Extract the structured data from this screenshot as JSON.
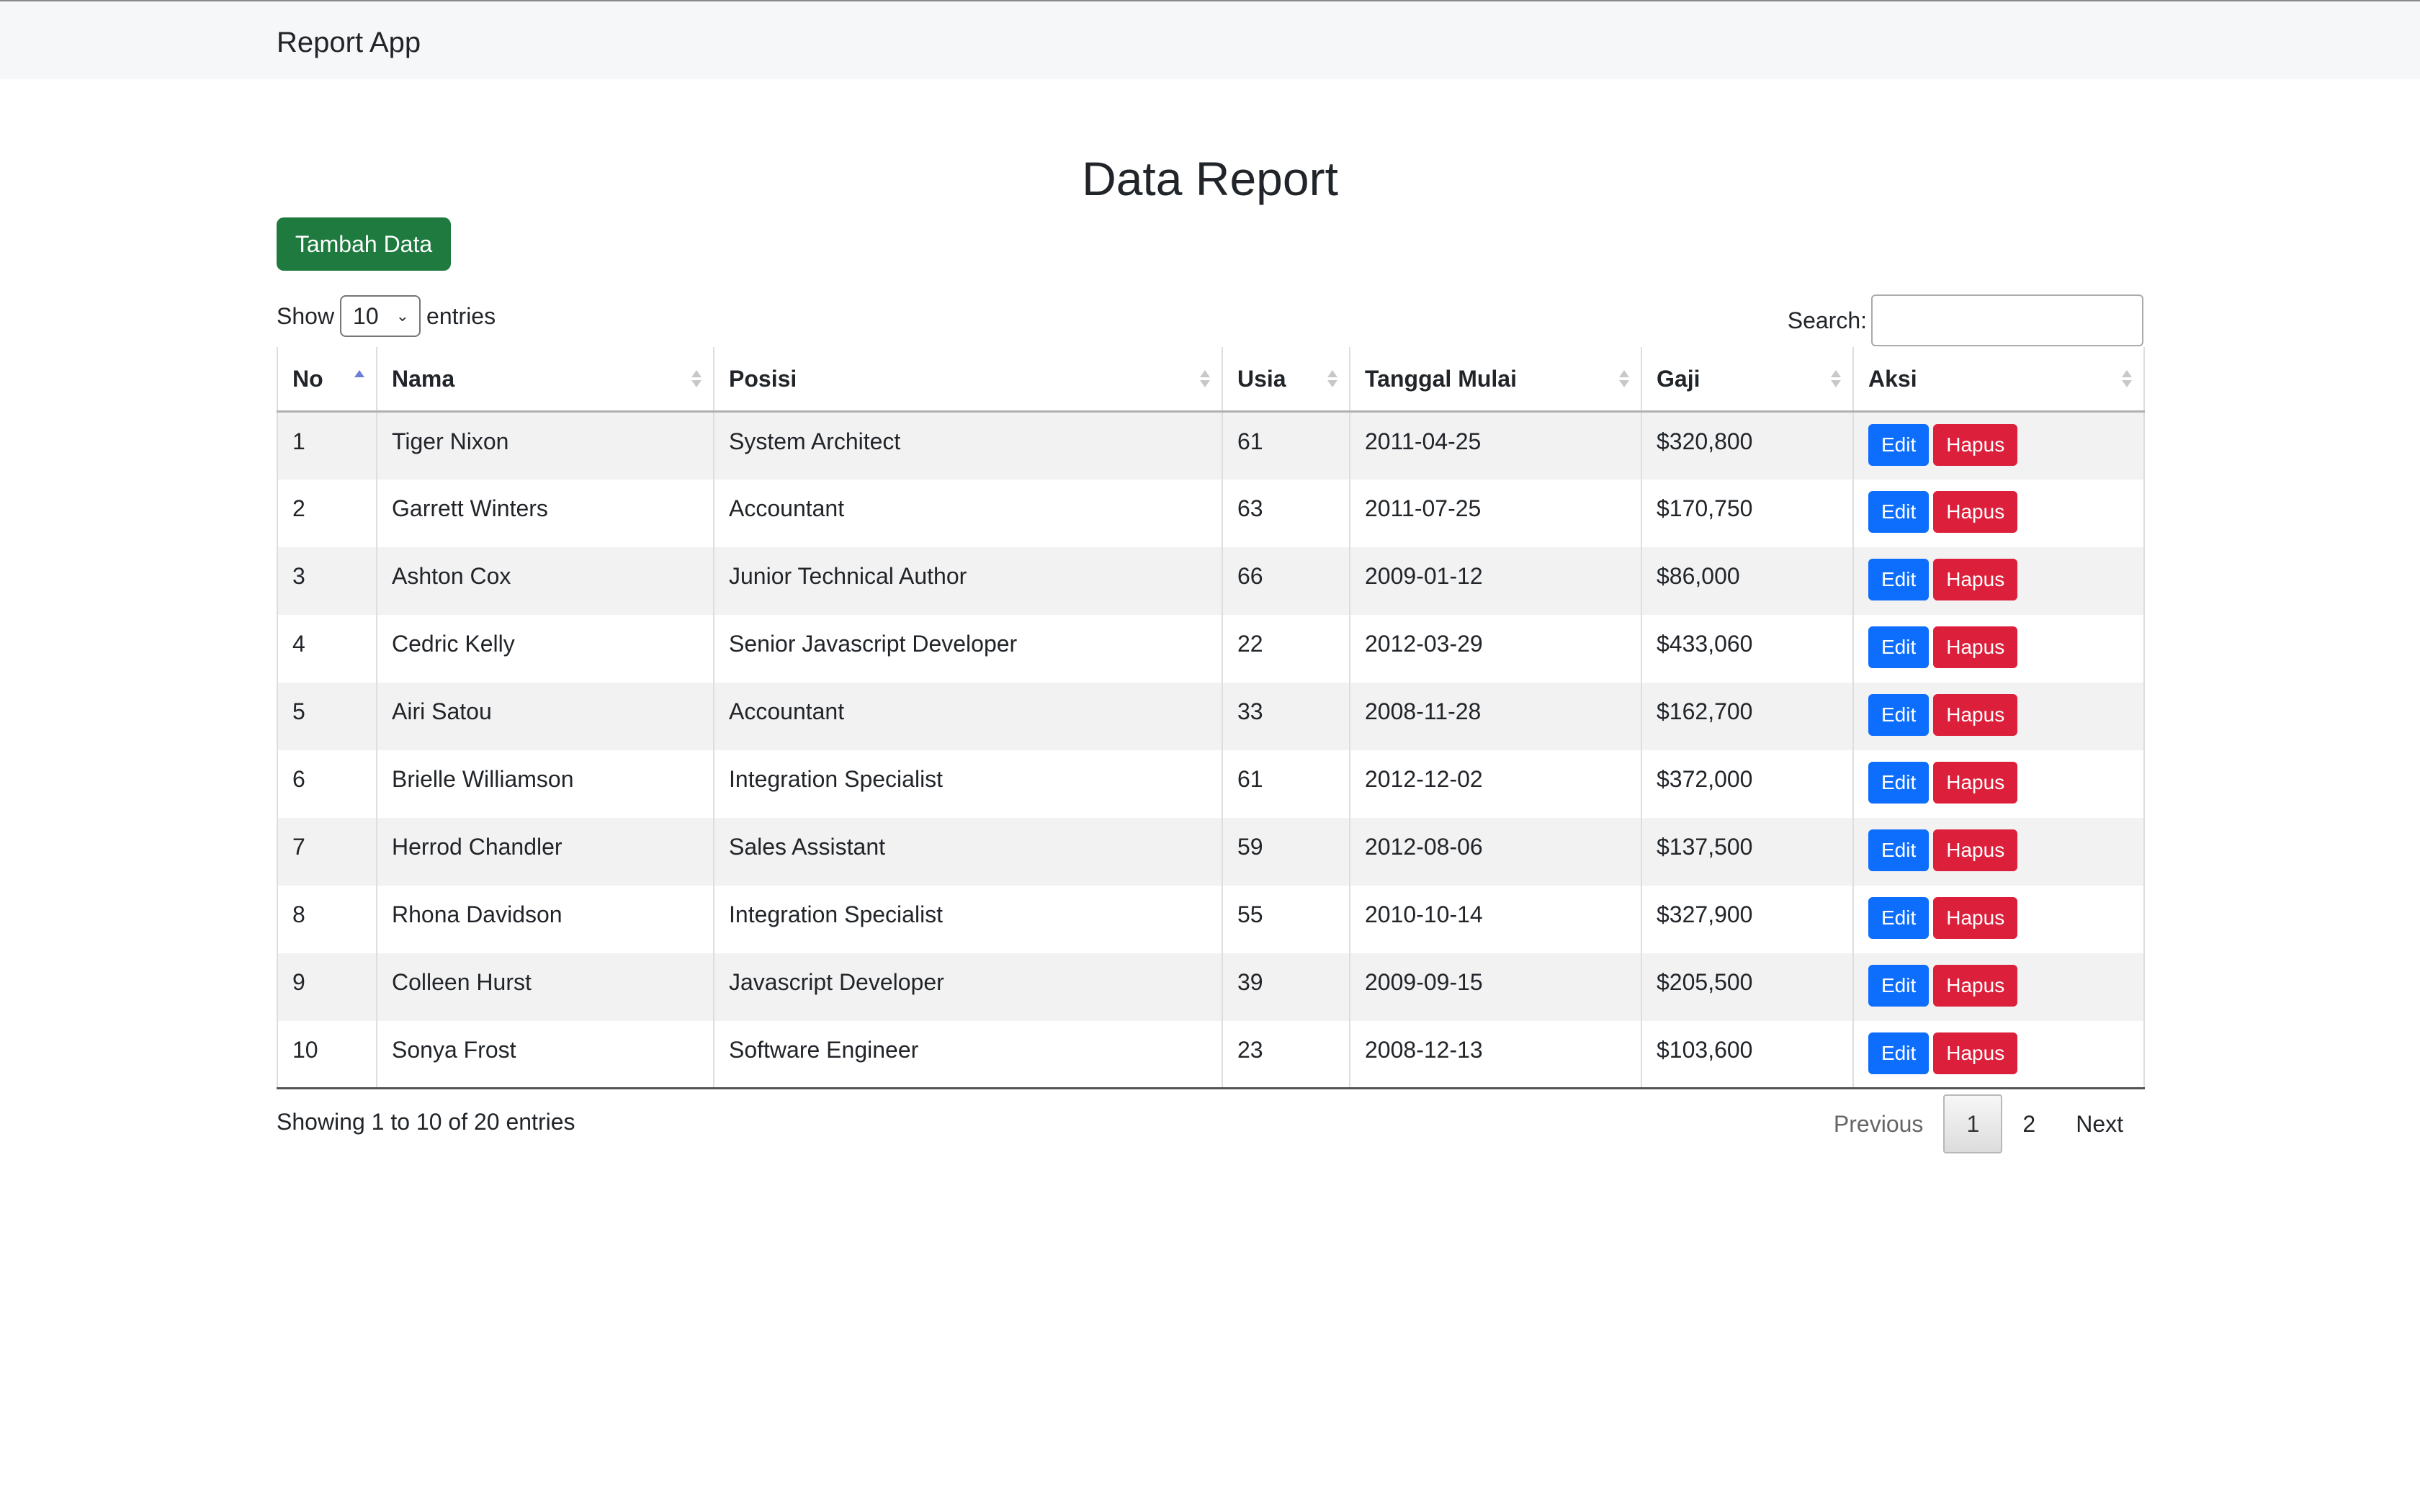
{
  "navbar": {
    "brand": "Report App"
  },
  "page": {
    "title": "Data Report",
    "add_button": "Tambah Data"
  },
  "length": {
    "prefix": "Show",
    "value": "10",
    "suffix": "entries"
  },
  "search": {
    "label": "Search:",
    "value": ""
  },
  "table": {
    "columns": [
      "No",
      "Nama",
      "Posisi",
      "Usia",
      "Tanggal Mulai",
      "Gaji",
      "Aksi"
    ],
    "sorted_column": "No",
    "edit_label": "Edit",
    "delete_label": "Hapus",
    "rows": [
      {
        "no": "1",
        "nama": "Tiger Nixon",
        "posisi": "System Architect",
        "usia": "61",
        "tanggal": "2011-04-25",
        "gaji": "$320,800"
      },
      {
        "no": "2",
        "nama": "Garrett Winters",
        "posisi": "Accountant",
        "usia": "63",
        "tanggal": "2011-07-25",
        "gaji": "$170,750"
      },
      {
        "no": "3",
        "nama": "Ashton Cox",
        "posisi": "Junior Technical Author",
        "usia": "66",
        "tanggal": "2009-01-12",
        "gaji": "$86,000"
      },
      {
        "no": "4",
        "nama": "Cedric Kelly",
        "posisi": "Senior Javascript Developer",
        "usia": "22",
        "tanggal": "2012-03-29",
        "gaji": "$433,060"
      },
      {
        "no": "5",
        "nama": "Airi Satou",
        "posisi": "Accountant",
        "usia": "33",
        "tanggal": "2008-11-28",
        "gaji": "$162,700"
      },
      {
        "no": "6",
        "nama": "Brielle Williamson",
        "posisi": "Integration Specialist",
        "usia": "61",
        "tanggal": "2012-12-02",
        "gaji": "$372,000"
      },
      {
        "no": "7",
        "nama": "Herrod Chandler",
        "posisi": "Sales Assistant",
        "usia": "59",
        "tanggal": "2012-08-06",
        "gaji": "$137,500"
      },
      {
        "no": "8",
        "nama": "Rhona Davidson",
        "posisi": "Integration Specialist",
        "usia": "55",
        "tanggal": "2010-10-14",
        "gaji": "$327,900"
      },
      {
        "no": "9",
        "nama": "Colleen Hurst",
        "posisi": "Javascript Developer",
        "usia": "39",
        "tanggal": "2009-09-15",
        "gaji": "$205,500"
      },
      {
        "no": "10",
        "nama": "Sonya Frost",
        "posisi": "Software Engineer",
        "usia": "23",
        "tanggal": "2008-12-13",
        "gaji": "$103,600"
      }
    ]
  },
  "info": "Showing 1 to 10 of 20 entries",
  "pagination": {
    "previous": "Previous",
    "pages": [
      "1",
      "2"
    ],
    "current": "1",
    "next": "Next"
  },
  "icons": {
    "sort": "sort-arrows-icon",
    "select": "chevron-down-icon"
  },
  "colors": {
    "add_button": "#1f7a3f",
    "edit_button": "#0d6efd",
    "delete_button": "#dc1f3b",
    "navbar_bg": "#f6f7f8"
  }
}
